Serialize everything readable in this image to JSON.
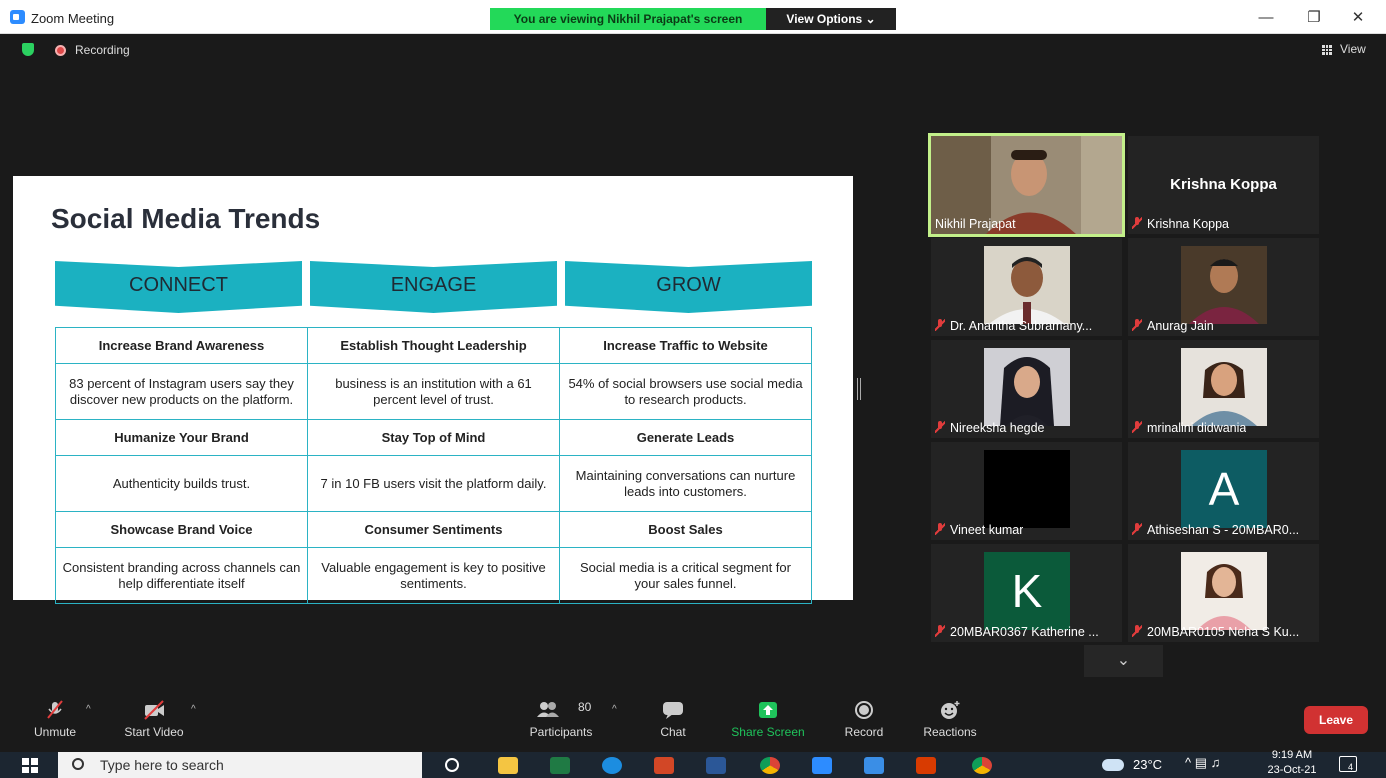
{
  "window": {
    "title": "Zoom Meeting",
    "viewing_banner": "You are viewing Nikhil Prajapat's screen",
    "view_options": "View Options ⌄",
    "minimize": "—",
    "restore": "❐",
    "close": "✕"
  },
  "meeting": {
    "recording_label": "Recording",
    "view_label": "View"
  },
  "slide": {
    "title": "Social Media Trends",
    "pillars": [
      "CONNECT",
      "ENGAGE",
      "GROW"
    ],
    "rows": [
      {
        "type": "head",
        "cells": [
          "Increase Brand Awareness",
          "Establish Thought Leadership",
          "Increase Traffic to Website"
        ]
      },
      {
        "type": "desc",
        "cells": [
          "83 percent of Instagram users say they discover new products on the platform.",
          "business is an institution with a 61 percent level of trust.",
          "54% of social browsers use social media to research products."
        ]
      },
      {
        "type": "head",
        "cells": [
          "Humanize Your Brand",
          "Stay Top of Mind",
          "Generate Leads"
        ]
      },
      {
        "type": "desc",
        "cells": [
          "Authenticity builds trust.",
          "7 in 10 FB users visit the platform daily.",
          "Maintaining conversations can nurture leads into customers."
        ]
      },
      {
        "type": "head",
        "cells": [
          "Showcase Brand Voice",
          "Consumer Sentiments",
          "Boost Sales"
        ]
      },
      {
        "type": "desc",
        "cells": [
          "Consistent branding across channels can help differentiate itself",
          "Valuable engagement is key to positive sentiments.",
          "Social media is a critical segment for your sales funnel."
        ]
      }
    ]
  },
  "participants": [
    {
      "name": "Nikhil Prajapat",
      "muted": false,
      "active": true
    },
    {
      "name": "Krishna Koppa",
      "muted": true,
      "display": "Krishna Koppa"
    },
    {
      "name": "Dr. Anantha Subramany...",
      "muted": true
    },
    {
      "name": "Anurag Jain",
      "muted": true
    },
    {
      "name": "Nireeksha hegde",
      "muted": true
    },
    {
      "name": "mrinalini didwania",
      "muted": true
    },
    {
      "name": "Vineet kumar",
      "muted": true
    },
    {
      "name": "Athiseshan S - 20MBAR0...",
      "muted": true,
      "letter": "A"
    },
    {
      "name": "20MBAR0367 Katherine ...",
      "muted": true,
      "letter": "K"
    },
    {
      "name": "20MBAR0105 Neha S Ku...",
      "muted": true
    }
  ],
  "scroll_down": "⌄",
  "toolbar": {
    "unmute": "Unmute",
    "start_video": "Start Video",
    "participants": "Participants",
    "participant_count": "80",
    "chat": "Chat",
    "share_screen": "Share Screen",
    "record": "Record",
    "reactions": "Reactions",
    "leave": "Leave",
    "caret": "^"
  },
  "taskbar": {
    "search_placeholder": "Type here to search",
    "weather": "23°C",
    "time": "9:19 AM",
    "date": "23-Oct-21",
    "notification_count": "4"
  },
  "colors": {
    "accent_teal": "#1bb1c1",
    "banner_green": "#23d959",
    "leave_red": "#d13232",
    "share_green": "#1fc35b"
  }
}
